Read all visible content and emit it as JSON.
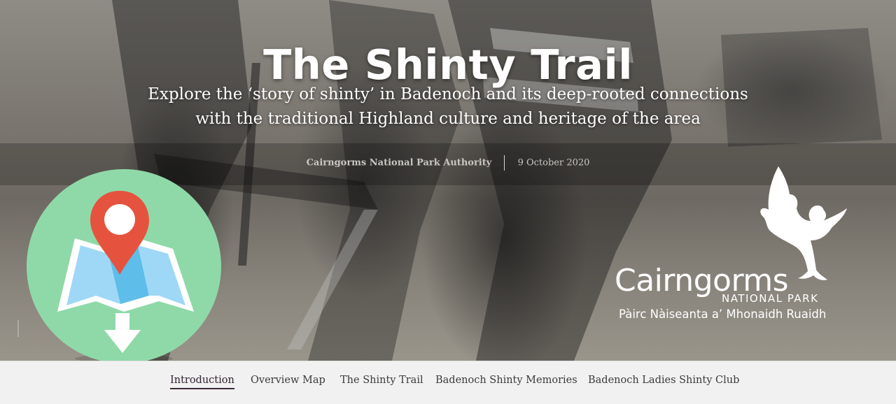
{
  "hero": {
    "title": "The Shinty Trail",
    "subtitle_line1": "Explore the ‘story of shinty’ in Badenoch and its deep-rooted connections",
    "subtitle_line2": "with the traditional Highland culture and heritage of the area",
    "author": "Cairngorms National Park Authority",
    "date": "9 October 2020"
  },
  "logo": {
    "name": "Cairngorms",
    "subname": "NATIONAL PARK",
    "gaelic": "Pàirc Nàiseanta a’ Mhonaidh Ruaidh"
  },
  "icons": {
    "map_download": "map-download-icon",
    "eagle": "eagle-logo-icon"
  },
  "colors": {
    "badge_bg": "#8fd9a8",
    "pin": "#e5533e",
    "map_blue": "#7cc8f0",
    "nav_active": "#3a2a3a"
  },
  "nav": {
    "items": [
      {
        "label": "Introduction",
        "active": true
      },
      {
        "label": "Overview Map",
        "active": false
      },
      {
        "label": "The Shinty Trail",
        "active": false
      },
      {
        "label": "Badenoch Shinty Memories",
        "active": false
      },
      {
        "label": "Badenoch Ladies Shinty Club",
        "active": false
      }
    ]
  }
}
